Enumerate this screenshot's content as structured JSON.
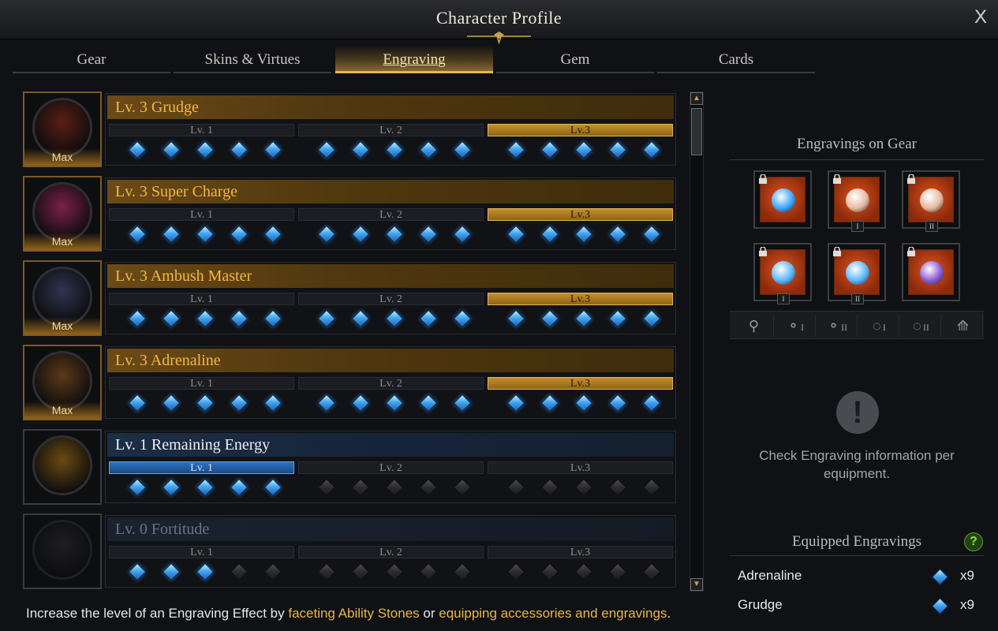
{
  "window": {
    "title": "Character Profile",
    "close_label": "X"
  },
  "tabs": [
    {
      "label": "Gear"
    },
    {
      "label": "Skins & Virtues"
    },
    {
      "label": "Engraving"
    },
    {
      "label": "Gem"
    },
    {
      "label": "Cards"
    }
  ],
  "active_tab": "Engraving",
  "engravings": [
    {
      "name": "Lv. 3 Grudge",
      "badge": "Max",
      "level": 3,
      "style": "gold",
      "filled_gems": 15,
      "levels": [
        "Lv. 1",
        "Lv. 2",
        "Lv.3"
      ]
    },
    {
      "name": "Lv. 3 Super Charge",
      "badge": "Max",
      "level": 3,
      "style": "gold",
      "filled_gems": 15,
      "levels": [
        "Lv. 1",
        "Lv. 2",
        "Lv.3"
      ]
    },
    {
      "name": "Lv. 3 Ambush Master",
      "badge": "Max",
      "level": 3,
      "style": "gold",
      "filled_gems": 15,
      "levels": [
        "Lv. 1",
        "Lv. 2",
        "Lv.3"
      ]
    },
    {
      "name": "Lv. 3 Adrenaline",
      "badge": "Max",
      "level": 3,
      "style": "gold",
      "filled_gems": 15,
      "levels": [
        "Lv. 1",
        "Lv. 2",
        "Lv.3"
      ]
    },
    {
      "name": "Lv. 1 Remaining Energy",
      "badge": "",
      "level": 1,
      "style": "blue",
      "filled_gems": 5,
      "levels": [
        "Lv. 1",
        "Lv. 2",
        "Lv.3"
      ]
    },
    {
      "name": "Lv. 0 Fortitude",
      "badge": "",
      "level": 0,
      "style": "dim",
      "filled_gems": 3,
      "levels": [
        "Lv. 1",
        "Lv. 2",
        "Lv.3"
      ]
    }
  ],
  "right_panel": {
    "gear_title": "Engravings on Gear",
    "gear_slots": [
      {
        "icon": "necklace-icon",
        "numeral": ""
      },
      {
        "icon": "earring-icon",
        "numeral": "I"
      },
      {
        "icon": "earring-icon",
        "numeral": "II"
      },
      {
        "icon": "ring-icon",
        "numeral": "I"
      },
      {
        "icon": "ring-icon",
        "numeral": "II"
      },
      {
        "icon": "ability-stone-icon",
        "numeral": ""
      }
    ],
    "filters": [
      {
        "icon": "necklace-filter-icon",
        "numeral": ""
      },
      {
        "icon": "earring-filter-icon",
        "numeral": "I"
      },
      {
        "icon": "earring-filter-icon",
        "numeral": "II"
      },
      {
        "icon": "ring-filter-icon",
        "numeral": "I"
      },
      {
        "icon": "ring-filter-icon",
        "numeral": "II"
      },
      {
        "icon": "stone-filter-icon",
        "numeral": ""
      }
    ],
    "info_mark": "!",
    "info_text": "Check Engraving information per equipment.",
    "equipped_title": "Equipped Engravings",
    "help_label": "?",
    "equipped": [
      {
        "name": "Adrenaline",
        "count": "x9"
      },
      {
        "name": "Grudge",
        "count": "x9"
      }
    ]
  },
  "footer": {
    "prefix": "Increase the level of an Engraving Effect by ",
    "link1": "faceting Ability Stones",
    "middle": " or ",
    "link2": "equipping accessories and engravings",
    "suffix": "."
  },
  "colors": {
    "accent_gold": "#e5b44f",
    "gem_blue": "#44a6ef",
    "help_green": "#8fe045"
  }
}
